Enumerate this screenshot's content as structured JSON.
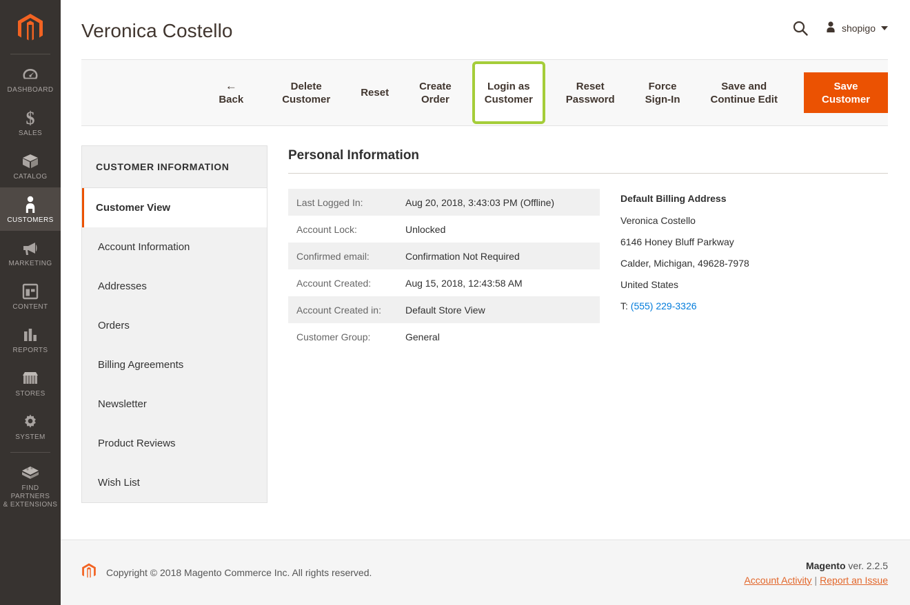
{
  "nav": {
    "logo_icon": "magento-logo-icon",
    "items": [
      {
        "label": "DASHBOARD",
        "icon": "dashboard-gauge-icon",
        "active": false
      },
      {
        "label": "SALES",
        "icon": "dollar-sign-icon",
        "active": false
      },
      {
        "label": "CATALOG",
        "icon": "box-icon",
        "active": false
      },
      {
        "label": "CUSTOMERS",
        "icon": "person-icon",
        "active": true
      },
      {
        "label": "MARKETING",
        "icon": "megaphone-icon",
        "active": false
      },
      {
        "label": "CONTENT",
        "icon": "layout-page-icon",
        "active": false
      },
      {
        "label": "REPORTS",
        "icon": "bar-chart-icon",
        "active": false
      },
      {
        "label": "STORES",
        "icon": "storefront-icon",
        "active": false
      },
      {
        "label": "SYSTEM",
        "icon": "gear-icon",
        "active": false
      },
      {
        "label": "FIND PARTNERS\n& EXTENSIONS",
        "icon": "extension-block-icon",
        "active": false
      }
    ]
  },
  "header": {
    "title": "Veronica Costello",
    "search_icon": "search-icon",
    "user_icon": "user-avatar-icon",
    "user_name": "shopigo",
    "caret_icon": "chevron-down-icon"
  },
  "toolbar": {
    "back": "Back",
    "back_arrow": "←",
    "delete_customer": "Delete\nCustomer",
    "reset": "Reset",
    "create_order": "Create\nOrder",
    "login_as_customer": "Login as\nCustomer",
    "reset_password": "Reset\nPassword",
    "force_sign_in": "Force\nSign-In",
    "save_and_continue": "Save and\nContinue Edit",
    "save_customer": "Save\nCustomer",
    "highlight_color": "#a5cd39",
    "primary_color": "#eb5202"
  },
  "side_tabs": {
    "title": "CUSTOMER INFORMATION",
    "items": [
      {
        "label": "Customer View",
        "active": true
      },
      {
        "label": "Account Information",
        "active": false
      },
      {
        "label": "Addresses",
        "active": false
      },
      {
        "label": "Orders",
        "active": false
      },
      {
        "label": "Billing Agreements",
        "active": false
      },
      {
        "label": "Newsletter",
        "active": false
      },
      {
        "label": "Product Reviews",
        "active": false
      },
      {
        "label": "Wish List",
        "active": false
      }
    ],
    "active_accent": "#eb5202"
  },
  "panel": {
    "title": "Personal Information",
    "rows": [
      {
        "label": "Last Logged In:",
        "value": "Aug 20, 2018, 3:43:03 PM (Offline)"
      },
      {
        "label": "Account Lock:",
        "value": "Unlocked"
      },
      {
        "label": "Confirmed email:",
        "value": "Confirmation Not Required"
      },
      {
        "label": "Account Created:",
        "value": "Aug 15, 2018, 12:43:58 AM"
      },
      {
        "label": "Account Created in:",
        "value": "Default Store View"
      },
      {
        "label": "Customer Group:",
        "value": "General"
      }
    ],
    "address": {
      "title": "Default Billing Address",
      "name": "Veronica Costello",
      "street": "6146 Honey Bluff Parkway",
      "city_state_zip": "Calder, Michigan, 49628-7978",
      "country": "United States",
      "phone_prefix": "T:",
      "phone": "(555) 229-3326",
      "phone_color": "#007bdb"
    }
  },
  "footer": {
    "logo_icon": "magento-logo-icon",
    "copyright": "Copyright © 2018 Magento Commerce Inc. All rights reserved.",
    "brand": "Magento",
    "version": " ver. 2.2.5",
    "account_activity": "Account Activity",
    "separator": "|",
    "report_issue": "Report an Issue"
  }
}
